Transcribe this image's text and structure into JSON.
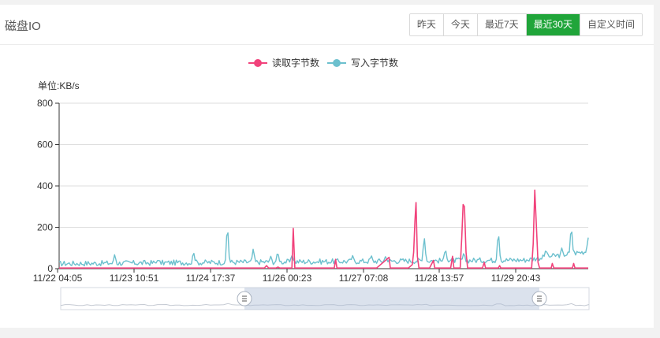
{
  "panel": {
    "title": "磁盘IO",
    "ranges": [
      "昨天",
      "今天",
      "最近7天",
      "最近30天",
      "自定义时间"
    ],
    "active_range": "最近30天"
  },
  "colors": {
    "read": "#f1427b",
    "write": "#6cc0ce",
    "active_button": "#20a53a"
  },
  "chart_data": {
    "type": "line",
    "unit_label": "单位:KB/s",
    "ylim": [
      0,
      800
    ],
    "y_ticks": [
      0,
      200,
      400,
      600,
      800
    ],
    "x_ticks": [
      "11/22 04:05",
      "11/23 10:51",
      "11/24 17:37",
      "11/26 00:23",
      "11/27 07:08",
      "11/28 13:57",
      "11/29 20:43"
    ],
    "grid": true,
    "legend_position": "top-center",
    "series": [
      {
        "name": "读取字节数",
        "color": "#f1427b",
        "points": [
          [
            0,
            3
          ],
          [
            0.2,
            3
          ],
          [
            0.35,
            3
          ],
          [
            0.388,
            3
          ],
          [
            0.392,
            15
          ],
          [
            0.396,
            3
          ],
          [
            0.41,
            3
          ],
          [
            0.4135,
            8
          ],
          [
            0.417,
            3
          ],
          [
            0.43,
            3
          ],
          [
            0.44,
            3
          ],
          [
            0.4425,
            195
          ],
          [
            0.4455,
            3
          ],
          [
            0.52,
            3
          ],
          [
            0.5225,
            45
          ],
          [
            0.525,
            3
          ],
          [
            0.56,
            3
          ],
          [
            0.6,
            3
          ],
          [
            0.6235,
            55
          ],
          [
            0.626,
            3
          ],
          [
            0.66,
            3
          ],
          [
            0.6675,
            20
          ],
          [
            0.67,
            80
          ],
          [
            0.6725,
            230
          ],
          [
            0.6745,
            320
          ],
          [
            0.677,
            60
          ],
          [
            0.68,
            3
          ],
          [
            0.7,
            3
          ],
          [
            0.7075,
            40
          ],
          [
            0.71,
            3
          ],
          [
            0.74,
            3
          ],
          [
            0.7435,
            60
          ],
          [
            0.746,
            3
          ],
          [
            0.758,
            3
          ],
          [
            0.761,
            150
          ],
          [
            0.7635,
            310
          ],
          [
            0.766,
            300
          ],
          [
            0.769,
            80
          ],
          [
            0.772,
            3
          ],
          [
            0.8,
            3
          ],
          [
            0.8035,
            30
          ],
          [
            0.806,
            3
          ],
          [
            0.83,
            3
          ],
          [
            0.8325,
            15
          ],
          [
            0.835,
            3
          ],
          [
            0.893,
            3
          ],
          [
            0.896,
            120
          ],
          [
            0.899,
            380
          ],
          [
            0.902,
            210
          ],
          [
            0.905,
            30
          ],
          [
            0.908,
            3
          ],
          [
            0.93,
            3
          ],
          [
            0.932,
            25
          ],
          [
            0.935,
            3
          ],
          [
            0.97,
            3
          ],
          [
            0.9725,
            25
          ],
          [
            0.975,
            3
          ],
          [
            1,
            3
          ]
        ]
      },
      {
        "name": "写入字节数",
        "color": "#6cc0ce",
        "base_level": 32,
        "spikes": [
          [
            0.105,
            70
          ],
          [
            0.187,
            45
          ],
          [
            0.254,
            85
          ],
          [
            0.318,
            225
          ],
          [
            0.367,
            100
          ],
          [
            0.4,
            60
          ],
          [
            0.413,
            85
          ],
          [
            0.44,
            70
          ],
          [
            0.555,
            65
          ],
          [
            0.59,
            65
          ],
          [
            0.617,
            60
          ],
          [
            0.69,
            160
          ],
          [
            0.73,
            100
          ],
          [
            0.765,
            80
          ],
          [
            0.83,
            190
          ],
          [
            0.92,
            95
          ],
          [
            0.95,
            100
          ],
          [
            0.968,
            215
          ],
          [
            1.0,
            150
          ]
        ]
      }
    ]
  }
}
